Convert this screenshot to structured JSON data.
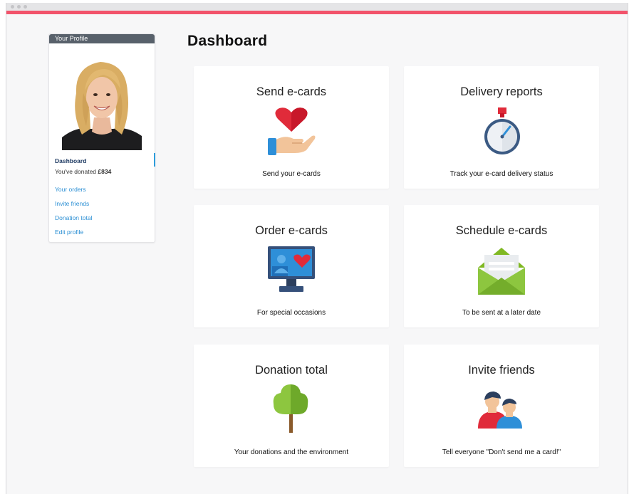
{
  "sidebar": {
    "header": "Your Profile",
    "title": "Dashboard",
    "donated_prefix": "You've donated ",
    "donated_amount": "£834",
    "links": [
      "Your orders",
      "Invite friends",
      "Donation total",
      "Edit profile"
    ]
  },
  "main": {
    "title": "Dashboard",
    "cards": [
      {
        "title": "Send e-cards",
        "subtitle": "Send your e-cards",
        "icon": "heart-hand-icon"
      },
      {
        "title": "Delivery reports",
        "subtitle": "Track your e-card delivery status",
        "icon": "stopwatch-icon"
      },
      {
        "title": "Order e-cards",
        "subtitle": "For special occasions",
        "icon": "monitor-heart-icon"
      },
      {
        "title": "Schedule e-cards",
        "subtitle": "To be sent at a later date",
        "icon": "envelope-icon"
      },
      {
        "title": "Donation total",
        "subtitle": "Your donations and the environment",
        "icon": "tree-icon"
      },
      {
        "title": "Invite friends",
        "subtitle": "Tell everyone \"Don't send me a card!\"",
        "icon": "friends-icon"
      }
    ]
  },
  "colors": {
    "accent": "#f2536b",
    "link": "#2b8fd4",
    "header_bg": "#58616b"
  }
}
